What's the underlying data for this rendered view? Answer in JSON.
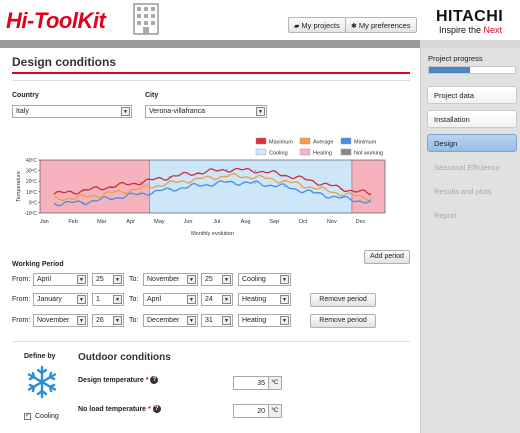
{
  "app": {
    "logo": "Hi-ToolKit"
  },
  "header": {
    "my_projects": "My projects",
    "my_preferences": "My preferences",
    "brand": "HITACHI",
    "tagline_pre": "Inspire the ",
    "tagline_post": "Next"
  },
  "sidebar": {
    "progress_label": "Project progress",
    "progress_fraction": 0.48,
    "items": [
      {
        "label": "Project data",
        "state": "normal"
      },
      {
        "label": "Installation",
        "state": "normal"
      },
      {
        "label": "Design",
        "state": "active"
      },
      {
        "label": "Seasonal Efficiency",
        "state": "disabled"
      },
      {
        "label": "Results and plots",
        "state": "disabled"
      },
      {
        "label": "Report",
        "state": "disabled"
      }
    ]
  },
  "page": {
    "title": "Design conditions",
    "country_label": "Country",
    "country_value": "Italy",
    "city_label": "City",
    "city_value": "Verona-villafranca"
  },
  "chart_data": {
    "type": "line",
    "xlabel": "Monthly evolution",
    "ylabel": "Temperature",
    "y_ticks": [
      "40ºC",
      "30ºC",
      "20ºC",
      "10ºC",
      "0ºC",
      "-10ºC"
    ],
    "ylim": [
      -10,
      40
    ],
    "x_ticks": [
      "Jan",
      "Feb",
      "Mar",
      "Apr",
      "May",
      "Jun",
      "Jul",
      "Aug",
      "Sep",
      "Oct",
      "Nov",
      "Dec"
    ],
    "legend": [
      {
        "label": "Maximum",
        "color": "#e0303a"
      },
      {
        "label": "Average",
        "color": "#f0a040"
      },
      {
        "label": "Minimum",
        "color": "#4a8ee0"
      },
      {
        "label": "Cooling",
        "color": "#cde6fa"
      },
      {
        "label": "Heating",
        "color": "#f6b2bd"
      },
      {
        "label": "Not working",
        "color": "#888888"
      }
    ],
    "regions": [
      {
        "mode": "Heating",
        "from_month": 0,
        "to_month": 3.8
      },
      {
        "mode": "Cooling",
        "from_month": 3.8,
        "to_month": 10.85
      },
      {
        "mode": "Heating",
        "from_month": 10.85,
        "to_month": 12
      }
    ],
    "series": [
      {
        "name": "Maximum",
        "color": "#c8303a",
        "values": [
          8,
          11,
          15,
          19,
          24,
          28,
          31,
          30,
          26,
          20,
          13,
          8
        ]
      },
      {
        "name": "Average",
        "color": "#e8a04a",
        "values": [
          3,
          5,
          9,
          13,
          18,
          22,
          25,
          24,
          20,
          14,
          8,
          4
        ]
      },
      {
        "name": "Minimum",
        "color": "#4a8ee0",
        "values": [
          -1,
          0,
          4,
          8,
          12,
          16,
          19,
          18,
          15,
          9,
          4,
          0
        ]
      }
    ]
  },
  "working_period": {
    "label": "Working Period",
    "add_label": "Add period",
    "from_label": "From:",
    "to_label": "To:",
    "remove_label": "Remove period",
    "rows": [
      {
        "from_month": "April",
        "from_day": "25",
        "to_month": "November",
        "to_day": "25",
        "mode": "Cooling"
      },
      {
        "from_month": "January",
        "from_day": "1",
        "to_month": "April",
        "to_day": "24",
        "mode": "Heating"
      },
      {
        "from_month": "November",
        "from_day": "26",
        "to_month": "December",
        "to_day": "31",
        "mode": "Heating"
      }
    ]
  },
  "outdoor": {
    "define_by": "Define by",
    "title": "Outdoor conditions",
    "design_temp_label": "Design temperature",
    "design_temp_value": "35",
    "no_load_label": "No load temperature",
    "no_load_value": "20",
    "required_mark": "*",
    "help_mark": "?",
    "unit": "ºC",
    "cooling_label": "Cooling",
    "cooling_checked": true
  }
}
